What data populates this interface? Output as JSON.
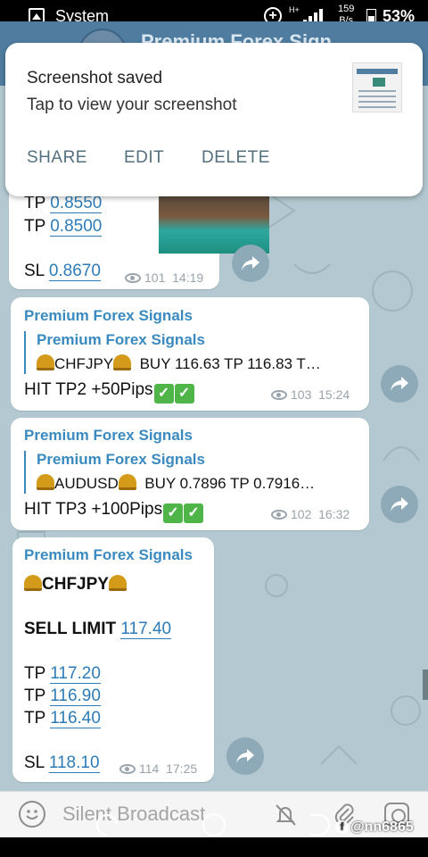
{
  "status_bar": {
    "app": "System",
    "network": "H+",
    "speed_value": "159",
    "speed_unit": "B/s",
    "battery": "53%"
  },
  "header": {
    "title": "Premium Forex Sign"
  },
  "notification": {
    "title": "Screenshot saved",
    "subtitle": "Tap to view your screenshot",
    "actions": [
      "SHARE",
      "EDIT",
      "DELETE"
    ]
  },
  "messages": [
    {
      "lines": [
        {
          "label": "TP",
          "value": "0.8550"
        },
        {
          "label": "TP",
          "value": "0.8500"
        },
        {
          "label": "SL",
          "value": "0.8670"
        }
      ],
      "views": "101",
      "time": "14:19"
    },
    {
      "sender": "Premium Forex Signals",
      "forward_name": "Premium Forex Signals",
      "forward_pair": "CHFJPY",
      "forward_text": "BUY 116.63  TP 116.83 T…",
      "body": "HIT TP2 +50Pips",
      "views": "103",
      "time": "15:24"
    },
    {
      "sender": "Premium Forex Signals",
      "forward_name": "Premium Forex Signals",
      "forward_pair": "AUDUSD",
      "forward_text": "BUY  0.7896  TP 0.7916…",
      "body": "HIT TP3 +100Pips",
      "views": "102",
      "time": "16:32"
    },
    {
      "sender": "Premium Forex Signals",
      "pair": "CHFJPY",
      "order_label": "SELL LIMIT",
      "order_value": "117.40",
      "lines": [
        {
          "label": "TP",
          "value": "117.20"
        },
        {
          "label": "TP",
          "value": "116.90"
        },
        {
          "label": "TP",
          "value": "116.40"
        },
        {
          "label": "SL",
          "value": "118.10"
        }
      ],
      "views": "114",
      "time": "17:25"
    }
  ],
  "input": {
    "placeholder": "Silent Broadcast"
  },
  "watermark": "@nn6865",
  "icons": {
    "emoji": "smile-icon",
    "mute": "bell-off-icon",
    "attach": "paperclip-icon",
    "camera": "camera-icon",
    "share": "share-arrow-icon",
    "views": "eye-icon"
  }
}
